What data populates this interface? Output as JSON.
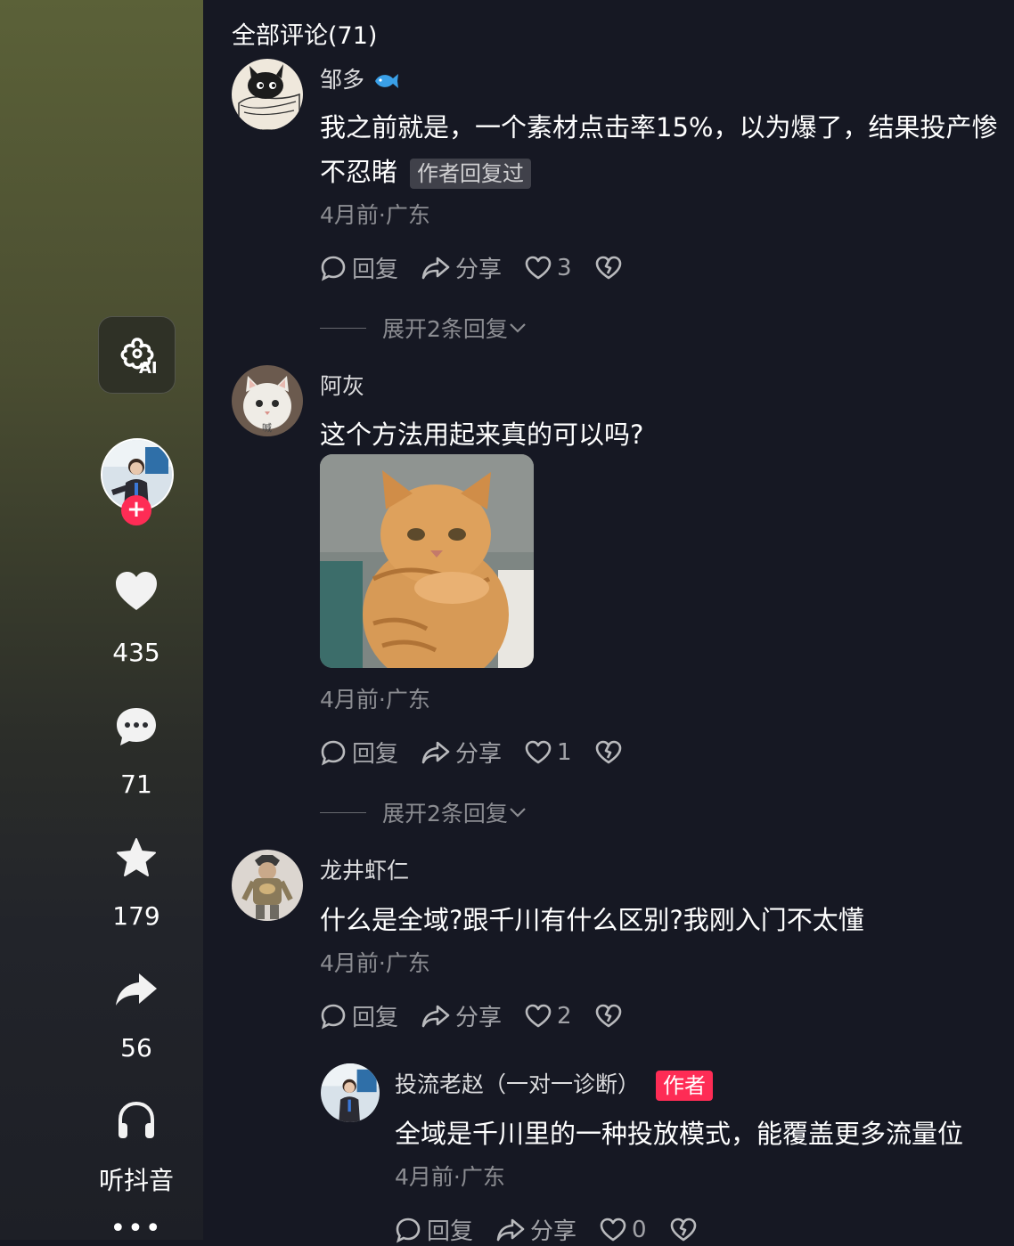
{
  "rail": {
    "ai_label": "AI",
    "like_count": "435",
    "comment_count": "71",
    "favorite_count": "179",
    "share_count": "56",
    "listen_label": "听抖音",
    "more_label": "•••",
    "follow_plus": "+"
  },
  "comments_header": {
    "title": "全部评论(71)"
  },
  "comments": [
    {
      "username": "邹多",
      "badge_icon": "fish-badge-icon",
      "text_line1": "我之前就是，一个素材点击率15%，以为爆了，结果投产惨",
      "text_line2": "不忍睹",
      "author_replied_tag": "作者回复过",
      "meta": "4月前·广东",
      "reply_label": "回复",
      "share_label": "分享",
      "like_count": "3",
      "expand_label": "展开2条回复"
    },
    {
      "username": "阿灰",
      "avatar_caption": "喊",
      "text": "这个方法用起来真的可以吗?",
      "has_sticker": true,
      "meta": "4月前·广东",
      "reply_label": "回复",
      "share_label": "分享",
      "like_count": "1",
      "expand_label": "展开2条回复"
    },
    {
      "username": "龙井虾仁",
      "text": "什么是全域?跟千川有什么区别?我刚入门不太懂",
      "meta": "4月前·广东",
      "reply_label": "回复",
      "share_label": "分享",
      "like_count": "2"
    }
  ],
  "reply": {
    "username": "投流老赵（一对一诊断）",
    "author_tag": "作者",
    "text": "全域是千川里的一种投放模式，能覆盖更多流量位",
    "meta": "4月前·广东",
    "reply_label": "回复",
    "share_label": "分享",
    "like_count": "0"
  },
  "colors": {
    "background": "#161823",
    "accent_red": "#fe2c55",
    "badge_blue": "#3aa0e8"
  }
}
